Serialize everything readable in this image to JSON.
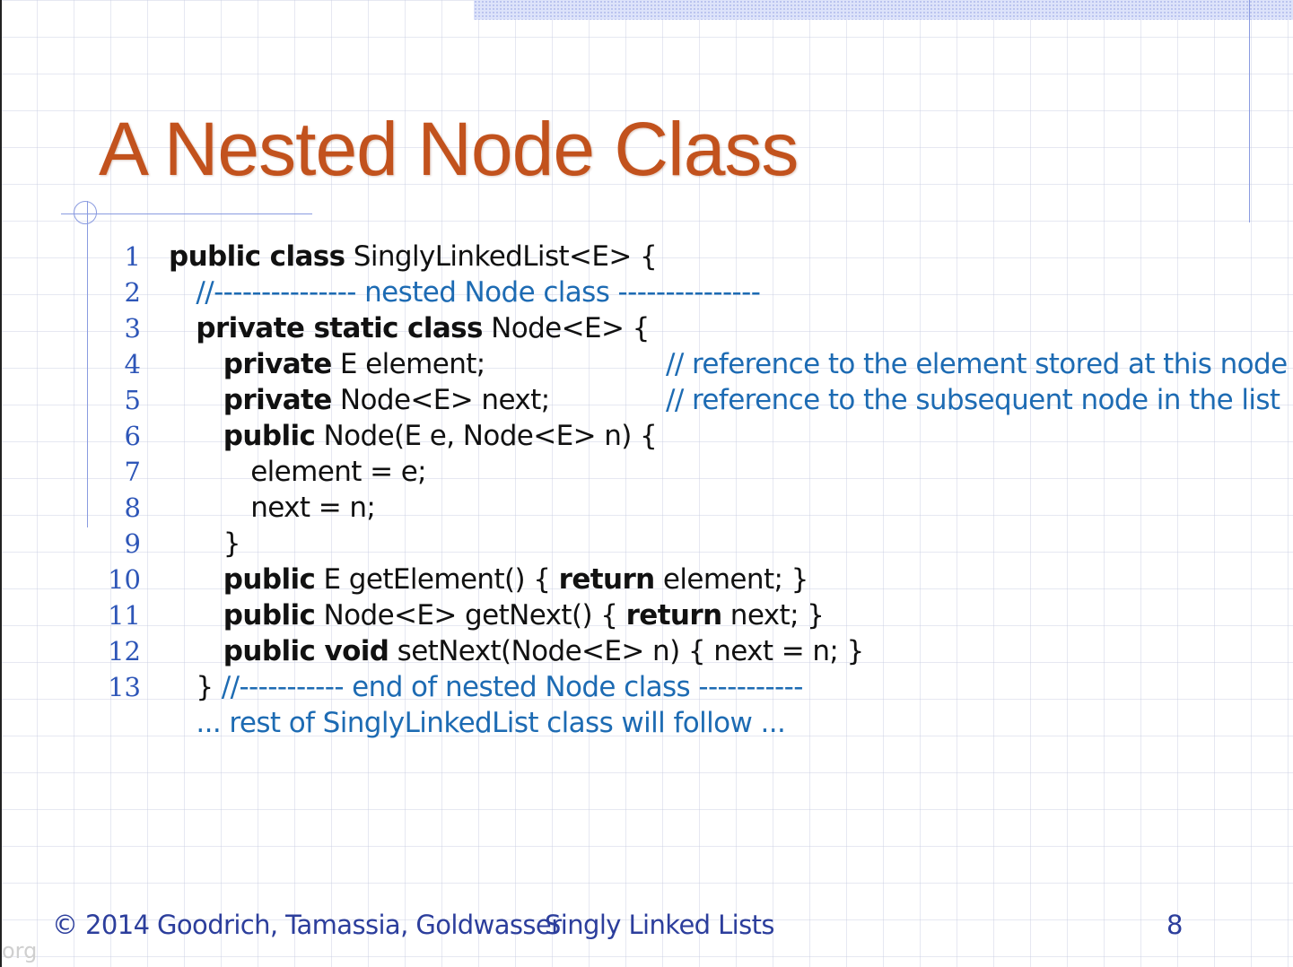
{
  "slide": {
    "title": "A Nested Node Class",
    "page_number": "8"
  },
  "code": {
    "lines": [
      {
        "n": "1",
        "parts": [
          {
            "t": "public class",
            "b": true
          },
          {
            "t": " SinglyLinkedList<E> {"
          }
        ],
        "comment": ""
      },
      {
        "n": "2",
        "parts": [
          {
            "t": "  //--------------- nested Node class ---------------",
            "c": true
          }
        ],
        "comment": ""
      },
      {
        "n": "3",
        "parts": [
          {
            "t": "  "
          },
          {
            "t": "private static class",
            "b": true
          },
          {
            "t": " Node<E> {"
          }
        ],
        "comment": ""
      },
      {
        "n": "4",
        "parts": [
          {
            "t": "    "
          },
          {
            "t": "private",
            "b": true
          },
          {
            "t": " E element;"
          }
        ],
        "comment": "// reference to the element stored at this node"
      },
      {
        "n": "5",
        "parts": [
          {
            "t": "    "
          },
          {
            "t": "private",
            "b": true
          },
          {
            "t": " Node<E> next;"
          }
        ],
        "comment": "// reference to the subsequent node in the list"
      },
      {
        "n": "6",
        "parts": [
          {
            "t": "    "
          },
          {
            "t": "public",
            "b": true
          },
          {
            "t": " Node(E e, Node<E> n) {"
          }
        ],
        "comment": ""
      },
      {
        "n": "7",
        "parts": [
          {
            "t": "      element = e;"
          }
        ],
        "comment": ""
      },
      {
        "n": "8",
        "parts": [
          {
            "t": "      next = n;"
          }
        ],
        "comment": ""
      },
      {
        "n": "9",
        "parts": [
          {
            "t": "    }"
          }
        ],
        "comment": ""
      },
      {
        "n": "10",
        "parts": [
          {
            "t": "    "
          },
          {
            "t": "public",
            "b": true
          },
          {
            "t": " E getElement() { "
          },
          {
            "t": "return",
            "b": true
          },
          {
            "t": " element; }"
          }
        ],
        "comment": ""
      },
      {
        "n": "11",
        "parts": [
          {
            "t": "    "
          },
          {
            "t": "public",
            "b": true
          },
          {
            "t": " Node<E> getNext() { "
          },
          {
            "t": "return",
            "b": true
          },
          {
            "t": " next; }"
          }
        ],
        "comment": ""
      },
      {
        "n": "12",
        "parts": [
          {
            "t": "    "
          },
          {
            "t": "public void",
            "b": true
          },
          {
            "t": " setNext(Node<E> n) { next = n; }"
          }
        ],
        "comment": ""
      },
      {
        "n": "13",
        "parts": [
          {
            "t": "  } "
          },
          {
            "t": "//----------- end of nested Node class -----------",
            "c": true
          }
        ],
        "comment": ""
      },
      {
        "n": "",
        "parts": [
          {
            "t": "  ... rest of SinglyLinkedList class will follow ...",
            "c": true
          }
        ],
        "comment": ""
      }
    ]
  },
  "footer": {
    "copyright": "© 2014 Goodrich, Tamassia, Goldwasser",
    "topic": "Singly Linked Lists"
  },
  "watermark": "org"
}
